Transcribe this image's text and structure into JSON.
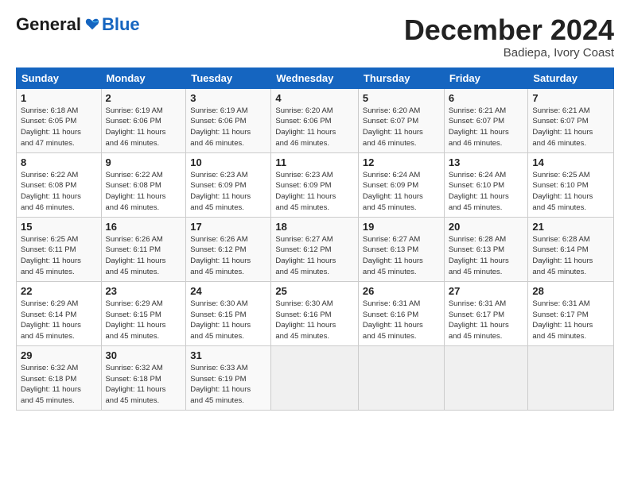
{
  "logo": {
    "general": "General",
    "blue": "Blue"
  },
  "header": {
    "month": "December 2024",
    "location": "Badiepa, Ivory Coast"
  },
  "days_of_week": [
    "Sunday",
    "Monday",
    "Tuesday",
    "Wednesday",
    "Thursday",
    "Friday",
    "Saturday"
  ],
  "weeks": [
    [
      {
        "day": 1,
        "info": "Sunrise: 6:18 AM\nSunset: 6:05 PM\nDaylight: 11 hours\nand 47 minutes."
      },
      {
        "day": 2,
        "info": "Sunrise: 6:19 AM\nSunset: 6:06 PM\nDaylight: 11 hours\nand 46 minutes."
      },
      {
        "day": 3,
        "info": "Sunrise: 6:19 AM\nSunset: 6:06 PM\nDaylight: 11 hours\nand 46 minutes."
      },
      {
        "day": 4,
        "info": "Sunrise: 6:20 AM\nSunset: 6:06 PM\nDaylight: 11 hours\nand 46 minutes."
      },
      {
        "day": 5,
        "info": "Sunrise: 6:20 AM\nSunset: 6:07 PM\nDaylight: 11 hours\nand 46 minutes."
      },
      {
        "day": 6,
        "info": "Sunrise: 6:21 AM\nSunset: 6:07 PM\nDaylight: 11 hours\nand 46 minutes."
      },
      {
        "day": 7,
        "info": "Sunrise: 6:21 AM\nSunset: 6:07 PM\nDaylight: 11 hours\nand 46 minutes."
      }
    ],
    [
      {
        "day": 8,
        "info": "Sunrise: 6:22 AM\nSunset: 6:08 PM\nDaylight: 11 hours\nand 46 minutes."
      },
      {
        "day": 9,
        "info": "Sunrise: 6:22 AM\nSunset: 6:08 PM\nDaylight: 11 hours\nand 46 minutes."
      },
      {
        "day": 10,
        "info": "Sunrise: 6:23 AM\nSunset: 6:09 PM\nDaylight: 11 hours\nand 45 minutes."
      },
      {
        "day": 11,
        "info": "Sunrise: 6:23 AM\nSunset: 6:09 PM\nDaylight: 11 hours\nand 45 minutes."
      },
      {
        "day": 12,
        "info": "Sunrise: 6:24 AM\nSunset: 6:09 PM\nDaylight: 11 hours\nand 45 minutes."
      },
      {
        "day": 13,
        "info": "Sunrise: 6:24 AM\nSunset: 6:10 PM\nDaylight: 11 hours\nand 45 minutes."
      },
      {
        "day": 14,
        "info": "Sunrise: 6:25 AM\nSunset: 6:10 PM\nDaylight: 11 hours\nand 45 minutes."
      }
    ],
    [
      {
        "day": 15,
        "info": "Sunrise: 6:25 AM\nSunset: 6:11 PM\nDaylight: 11 hours\nand 45 minutes."
      },
      {
        "day": 16,
        "info": "Sunrise: 6:26 AM\nSunset: 6:11 PM\nDaylight: 11 hours\nand 45 minutes."
      },
      {
        "day": 17,
        "info": "Sunrise: 6:26 AM\nSunset: 6:12 PM\nDaylight: 11 hours\nand 45 minutes."
      },
      {
        "day": 18,
        "info": "Sunrise: 6:27 AM\nSunset: 6:12 PM\nDaylight: 11 hours\nand 45 minutes."
      },
      {
        "day": 19,
        "info": "Sunrise: 6:27 AM\nSunset: 6:13 PM\nDaylight: 11 hours\nand 45 minutes."
      },
      {
        "day": 20,
        "info": "Sunrise: 6:28 AM\nSunset: 6:13 PM\nDaylight: 11 hours\nand 45 minutes."
      },
      {
        "day": 21,
        "info": "Sunrise: 6:28 AM\nSunset: 6:14 PM\nDaylight: 11 hours\nand 45 minutes."
      }
    ],
    [
      {
        "day": 22,
        "info": "Sunrise: 6:29 AM\nSunset: 6:14 PM\nDaylight: 11 hours\nand 45 minutes."
      },
      {
        "day": 23,
        "info": "Sunrise: 6:29 AM\nSunset: 6:15 PM\nDaylight: 11 hours\nand 45 minutes."
      },
      {
        "day": 24,
        "info": "Sunrise: 6:30 AM\nSunset: 6:15 PM\nDaylight: 11 hours\nand 45 minutes."
      },
      {
        "day": 25,
        "info": "Sunrise: 6:30 AM\nSunset: 6:16 PM\nDaylight: 11 hours\nand 45 minutes."
      },
      {
        "day": 26,
        "info": "Sunrise: 6:31 AM\nSunset: 6:16 PM\nDaylight: 11 hours\nand 45 minutes."
      },
      {
        "day": 27,
        "info": "Sunrise: 6:31 AM\nSunset: 6:17 PM\nDaylight: 11 hours\nand 45 minutes."
      },
      {
        "day": 28,
        "info": "Sunrise: 6:31 AM\nSunset: 6:17 PM\nDaylight: 11 hours\nand 45 minutes."
      }
    ],
    [
      {
        "day": 29,
        "info": "Sunrise: 6:32 AM\nSunset: 6:18 PM\nDaylight: 11 hours\nand 45 minutes."
      },
      {
        "day": 30,
        "info": "Sunrise: 6:32 AM\nSunset: 6:18 PM\nDaylight: 11 hours\nand 45 minutes."
      },
      {
        "day": 31,
        "info": "Sunrise: 6:33 AM\nSunset: 6:19 PM\nDaylight: 11 hours\nand 45 minutes."
      },
      null,
      null,
      null,
      null
    ]
  ]
}
